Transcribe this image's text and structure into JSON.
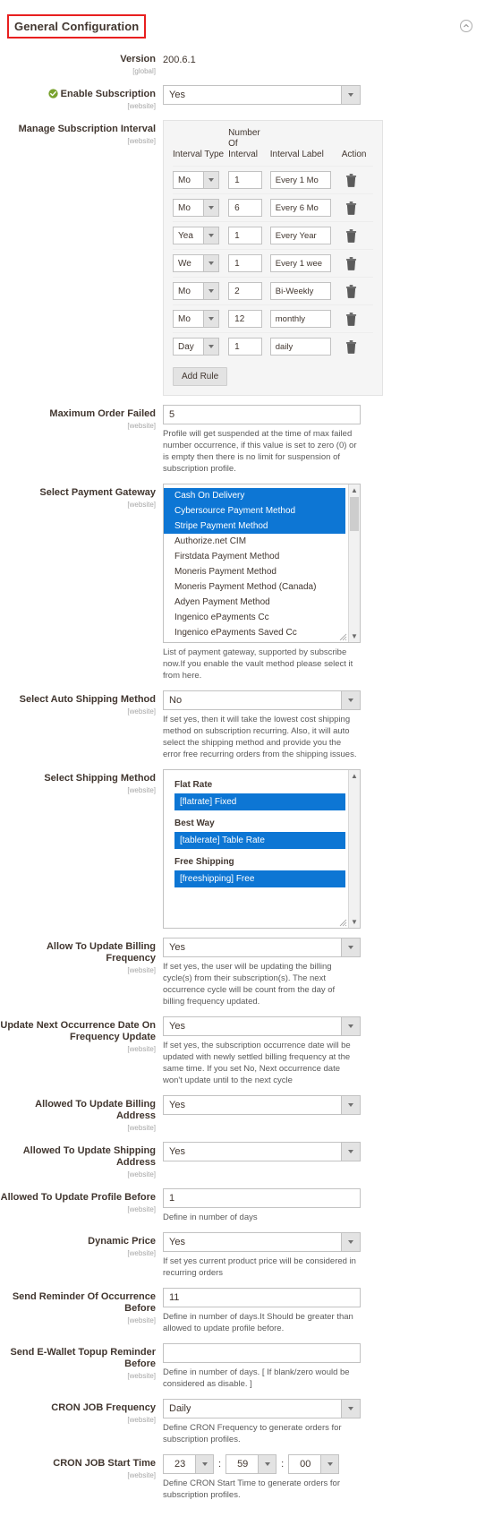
{
  "header": {
    "title": "General Configuration",
    "collapse_icon": "chevron-up-circle-icon"
  },
  "fields": {
    "version": {
      "label": "Version",
      "scope": "[global]",
      "value": "200.6.1"
    },
    "enable_subscription": {
      "label": "Enable Subscription",
      "scope": "[website]",
      "icon": "green-check-badge-icon",
      "value": "Yes"
    },
    "manage_interval": {
      "label": "Manage Subscription Interval",
      "scope": "[website]",
      "columns": [
        "Interval Type",
        "Number Of Interval",
        "Interval Label",
        "Action"
      ],
      "rows": [
        {
          "type": "Mo",
          "number": "1",
          "interval_label": "Every 1 Mo"
        },
        {
          "type": "Mo",
          "number": "6",
          "interval_label": "Every 6 Mo"
        },
        {
          "type": "Yea",
          "number": "1",
          "interval_label": "Every Year"
        },
        {
          "type": "We",
          "number": "1",
          "interval_label": "Every 1 wee"
        },
        {
          "type": "Mo",
          "number": "2",
          "interval_label": "Bi-Weekly"
        },
        {
          "type": "Mo",
          "number": "12",
          "interval_label": "monthly"
        },
        {
          "type": "Day",
          "number": "1",
          "interval_label": "daily"
        }
      ],
      "delete_icon": "trash-icon",
      "add_button": "Add Rule"
    },
    "maximum_order_failed": {
      "label": "Maximum Order Failed",
      "scope": "[website]",
      "value": "5",
      "note": "Profile will get suspended at the time of max failed number occurrence, if this value is set to zero (0) or is empty then there is no limit for suspension of subscription profile."
    },
    "select_payment_gateway": {
      "label": "Select Payment Gateway",
      "scope": "[website]",
      "options": [
        {
          "text": "Cash On Delivery",
          "selected": true
        },
        {
          "text": "Cybersource Payment Method",
          "selected": true
        },
        {
          "text": "Stripe Payment Method",
          "selected": true
        },
        {
          "text": "Authorize.net CIM",
          "selected": false
        },
        {
          "text": "Firstdata Payment Method",
          "selected": false
        },
        {
          "text": "Moneris Payment Method",
          "selected": false
        },
        {
          "text": "Moneris Payment Method (Canada)",
          "selected": false
        },
        {
          "text": "Adyen Payment Method",
          "selected": false
        },
        {
          "text": "Ingenico ePayments Cc",
          "selected": false
        },
        {
          "text": "Ingenico ePayments Saved Cc",
          "selected": false
        }
      ],
      "note": "List of payment gateway, supported by subscribe now.If you enable the vault method please select it from here."
    },
    "select_auto_shipping_method": {
      "label": "Select Auto Shipping Method",
      "scope": "[website]",
      "value": "No",
      "note": "If set yes, then it will take the lowest cost shipping method on subscription recurring. Also, it will auto select the shipping method and provide you the error free recurring orders from the shipping issues."
    },
    "select_shipping_method": {
      "label": "Select Shipping Method",
      "scope": "[website]",
      "groups": [
        {
          "group": "Flat Rate",
          "option": "[flatrate] Fixed",
          "selected": true
        },
        {
          "group": "Best Way",
          "option": "[tablerate] Table Rate",
          "selected": true
        },
        {
          "group": "Free Shipping",
          "option": "[freeshipping] Free",
          "selected": true
        }
      ]
    },
    "allow_update_billing_frequency": {
      "label": "Allow To Update Billing Frequency",
      "scope": "[website]",
      "value": "Yes",
      "note": "If set yes, the user will be updating the billing cycle(s) from their subscription(s). The next occurrence cycle will be count from the day of billing frequency updated."
    },
    "update_next_occurrence_date": {
      "label": "Update Next Occurrence Date On Frequency Update",
      "scope": "[website]",
      "value": "Yes",
      "note": "If set yes, the subscription occurrence date will be updated with newly settled billing frequency at the same time. If you set No, Next occurrence date won't update until to the next cycle"
    },
    "allowed_update_billing_address": {
      "label": "Allowed To Update Billing Address",
      "scope": "[website]",
      "value": "Yes"
    },
    "allowed_update_shipping_address": {
      "label": "Allowed To Update Shipping Address",
      "scope": "[website]",
      "value": "Yes"
    },
    "allowed_update_profile_before": {
      "label": "Allowed To Update Profile Before",
      "scope": "[website]",
      "value": "1",
      "note": "Define in number of days"
    },
    "dynamic_price": {
      "label": "Dynamic Price",
      "scope": "[website]",
      "value": "Yes",
      "note": "If set yes current product price will be considered in recurring orders"
    },
    "send_reminder_of_occurrence_before": {
      "label": "Send Reminder Of Occurrence Before",
      "scope": "[website]",
      "value": "11",
      "note": "Define in number of days.It Should be greater than allowed to update profile before."
    },
    "send_ewallet_topup_reminder_before": {
      "label": "Send E-Wallet Topup Reminder Before",
      "scope": "[website]",
      "value": "",
      "note": "Define in number of days. [ If blank/zero would be considered as disable. ]"
    },
    "cron_job_frequency": {
      "label": "CRON JOB Frequency",
      "scope": "[website]",
      "value": "Daily",
      "note": "Define CRON Frequency to generate orders for subscription profiles."
    },
    "cron_job_start_time": {
      "label": "CRON JOB Start Time",
      "scope": "[website]",
      "hours": "23",
      "minutes": "59",
      "seconds": "00",
      "separator": ":",
      "note": "Define CRON Start Time to generate orders for subscription profiles."
    }
  },
  "colors": {
    "accent_selected": "#0d76d4",
    "highlight_box": "#e81f1f",
    "label_text": "#41362f",
    "check_green": "#79a22e"
  }
}
